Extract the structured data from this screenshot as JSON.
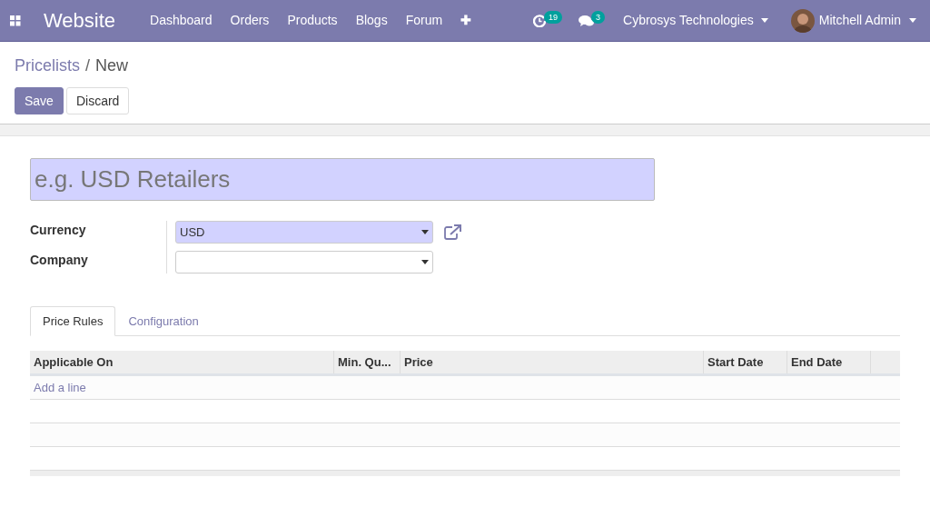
{
  "navbar": {
    "app_title": "Website",
    "menu": [
      "Dashboard",
      "Orders",
      "Products",
      "Blogs",
      "Forum",
      "✚"
    ],
    "activity_count": "19",
    "messages_count": "3",
    "company": "Cybrosys Technologies",
    "user": "Mitchell Admin"
  },
  "breadcrumb": [
    "Pricelists",
    "New"
  ],
  "breadcrumb_separator": "/",
  "buttons": [
    {
      "label": "Save",
      "kind": "primary"
    },
    {
      "label": "Discard",
      "kind": "secondary"
    }
  ],
  "form": {
    "name": {
      "placeholder": "e.g. USD Retailers"
    },
    "fields": [
      {
        "label": "Currency",
        "value": "USD",
        "required": true,
        "external_link": true
      },
      {
        "label": "Company",
        "required": false,
        "external_link": false
      }
    ]
  },
  "tabs": [
    {
      "label": "Price Rules",
      "selected": true
    },
    {
      "label": "Configuration",
      "selected": false
    }
  ],
  "table": {
    "columns": [
      "Applicable On",
      "Min. Qu...",
      "Price",
      "Start Date",
      "End Date"
    ],
    "add_line": "Add a line"
  }
}
